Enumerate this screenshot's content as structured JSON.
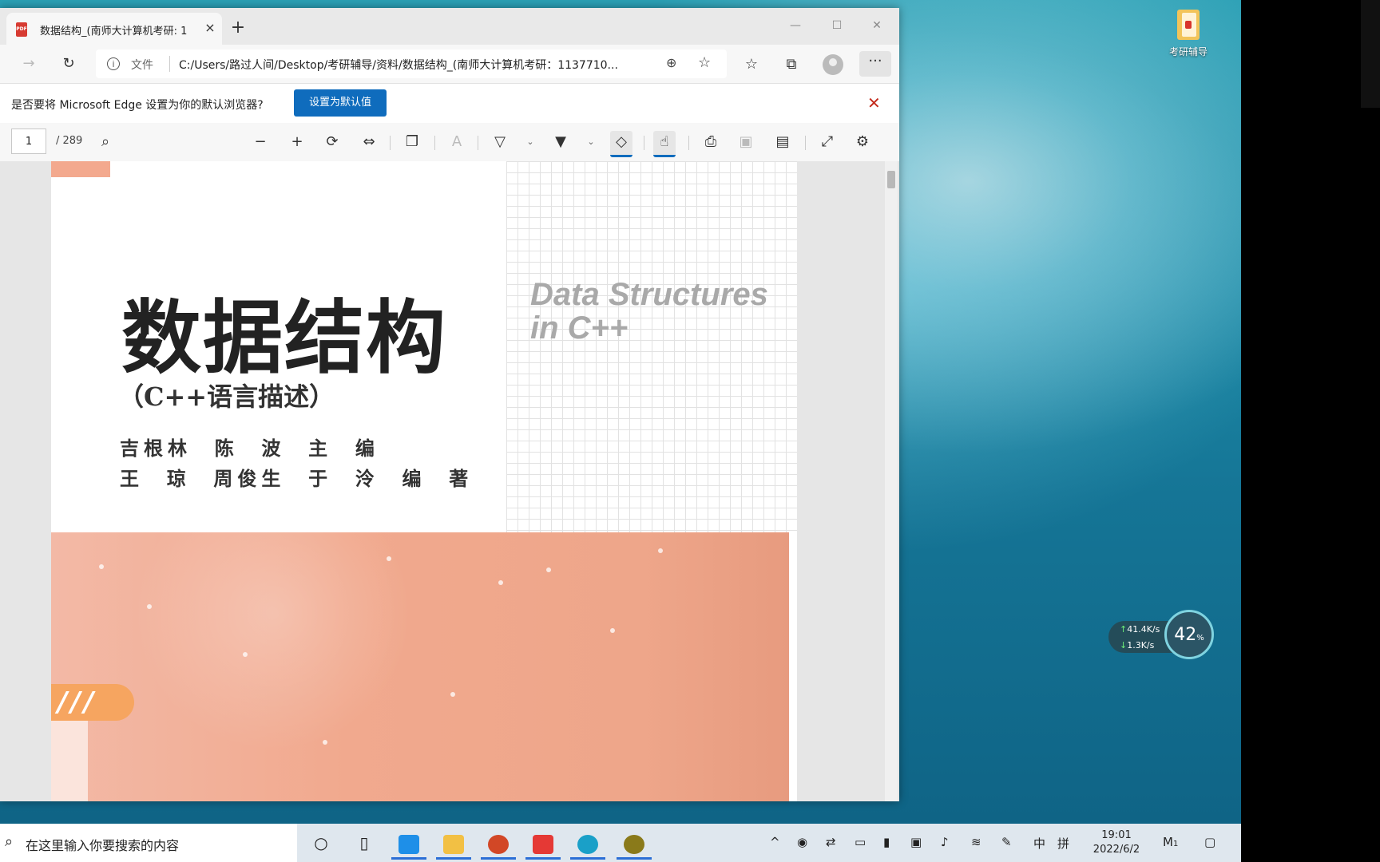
{
  "desktop": {
    "icon_label": "考研辅导",
    "net_monitor": {
      "up": "41.4K/s",
      "down": "1.3K/s",
      "percent": "42",
      "percent_unit": "%"
    }
  },
  "browser": {
    "tab_title": "数据结构_(南师大计算机考研: 1",
    "tab_close": "×",
    "new_tab": "+",
    "window_controls": {
      "minimize": "—",
      "maximize": "☐",
      "close": "✕"
    },
    "address": {
      "scheme_label": "文件",
      "url": "C:/Users/路过人间/Desktop/考研辅导/资料/数据结构_(南师大计算机考研：1137710..."
    },
    "infobar": {
      "message": "是否要将 Microsoft Edge 设置为你的默认浏览器?",
      "button": "设置为默认值"
    },
    "pdf_toolbar": {
      "page": "1",
      "total": "/ 289"
    }
  },
  "pdf_page": {
    "cn_title": "数据结构",
    "en_title_line1": "Data Structures",
    "en_title_line2": "in C++",
    "subtitle": "（C++语言描述）",
    "authors_line1": "吉根林  陈  波  主  编",
    "authors_line2": "王  琼  周俊生  于  泠  编  著",
    "badge": "///"
  },
  "taskbar": {
    "search_placeholder": "在这里输入你要搜索的内容",
    "tray": {
      "ime_lang": "中",
      "ime_mode": "拼",
      "notif": "1"
    },
    "time": "19:01",
    "date": "2022/6/2"
  },
  "colors": {
    "accent": "#0f6cbd",
    "pdf_band": "#f1a98e",
    "close_red": "#c42b1c"
  }
}
